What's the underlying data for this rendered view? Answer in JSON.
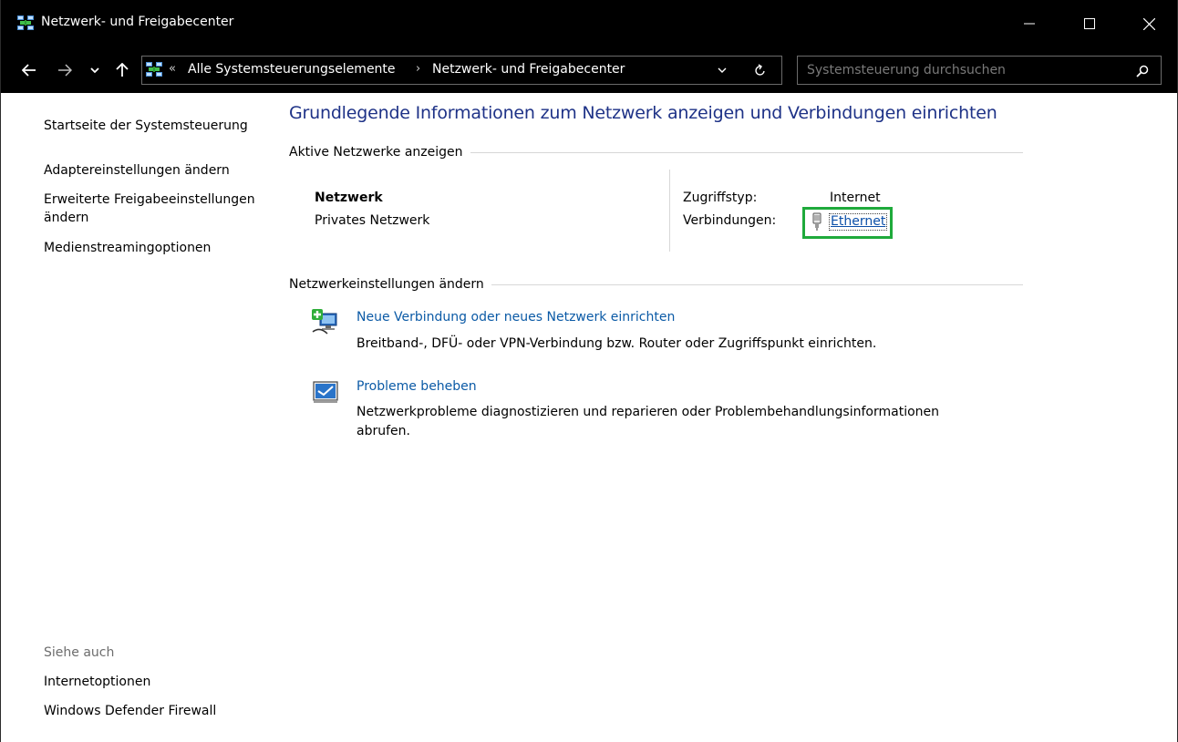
{
  "window": {
    "title": "Netzwerk- und Freigabecenter",
    "controls": {
      "minimize": "minimize-icon",
      "maximize": "maximize-icon",
      "close": "close-icon"
    }
  },
  "navigation": {
    "breadcrumb_overflow": "«",
    "breadcrumbs": [
      "Alle Systemsteuerungselemente",
      "Netzwerk- und Freigabecenter"
    ],
    "separator": "›",
    "search_placeholder": "Systemsteuerung durchsuchen"
  },
  "left_pane": {
    "home": "Startseite der Systemsteuerung",
    "tasks": [
      "Adaptereinstellungen ändern",
      "Erweiterte Freigabeeinstellungen ändern",
      "Medienstreamingoptionen"
    ],
    "see_also_heading": "Siehe auch",
    "see_also": [
      "Internetoptionen",
      "Windows Defender Firewall"
    ]
  },
  "main": {
    "title": "Grundlegende Informationen zum Netzwerk anzeigen und Verbindungen einrichten",
    "active_networks_heading": "Aktive Netzwerke anzeigen",
    "network": {
      "name": "Netzwerk",
      "type": "Privates Netzwerk",
      "access_label": "Zugriffstyp:",
      "access_value": "Internet",
      "connections_label": "Verbindungen:",
      "connection_name": "Ethernet"
    },
    "change_settings_heading": "Netzwerkeinstellungen ändern",
    "tasks": [
      {
        "label": "Neue Verbindung oder neues Netzwerk einrichten",
        "description": "Breitband-, DFÜ- oder VPN-Verbindung bzw. Router oder Zugriffspunkt einrichten."
      },
      {
        "label": "Probleme beheben",
        "description": "Netzwerkprobleme diagnostizieren und reparieren oder Problembehandlungsinformationen abrufen."
      }
    ]
  },
  "colors": {
    "title_blue": "#1e3287",
    "link_blue": "#0b5aa6",
    "highlight_green": "#1faa3b",
    "chrome_black": "#000000"
  }
}
